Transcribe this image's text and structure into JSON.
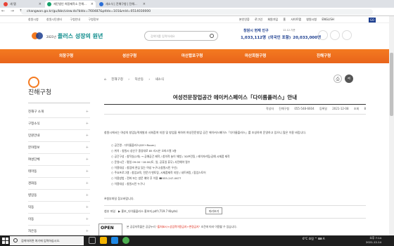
{
  "browser": {
    "tabs": [
      {
        "label": "새 탭",
        "active": false,
        "color": "#e94235"
      },
      {
        "label": "재단법인 희망제작소 진해...",
        "active": true,
        "color": "#15a06b"
      },
      {
        "label": "새소식 | 진해구청 | 진해...",
        "active": false,
        "color": "#2a6ed6"
      }
    ],
    "nav_icons": "← → ↻",
    "url": "changwon.go.kr/gu/bbs/view.do?bIdx=760487&ptIdx=101&mId=0514030000"
  },
  "util": {
    "left_links": [
      "창원시청",
      "창원시민센터",
      "구청안내",
      "구청정보"
    ],
    "right_links": [
      "본인인증",
      "로그인",
      "회원가입",
      "홈",
      "사이트맵",
      "창원시청",
      "ENGLISH"
    ],
    "go": "GO"
  },
  "logo": {
    "small": "2021년",
    "main": "플러스 성장의 원년"
  },
  "search": {
    "placeholder": "검색어를 입력하세요"
  },
  "population": {
    "title": "창원시 현재 인구",
    "date": "12.12.기준",
    "values": [
      "1,033,112명",
      "(외국인 포함)",
      "20,033,000명"
    ]
  },
  "gnb": [
    "의창구청",
    "성산구청",
    "마산합포구청",
    "마산회원구청",
    "진해구청"
  ],
  "lnb": {
    "title": "진해구청",
    "items": [
      "진해구 소개",
      "구정소식",
      "민원안내",
      "분야정보",
      "여성단체",
      "테마동",
      "경화동",
      "병암동",
      "덕동",
      "이동",
      "자은동"
    ]
  },
  "main": {
    "breadcrumb": [
      "진해구청",
      "덕산동",
      "새소식"
    ],
    "print_icon": "print-icon",
    "share_icon": "share-icon",
    "title": "여성전문창업공간 에이커스페이스「다이룸플러스」안내",
    "meta": {
      "writer_label": "작성자",
      "writer": "진해구청",
      "phone": "055-548-6604",
      "date_label": "등록일",
      "date": "2021-12-08",
      "views_label": "조회",
      "views": "8"
    },
    "intro": "창원시에서는 여성의 창업능력개발과 사회참여 지원 및 창업을 위하여 여성전문창업 공간 에이커스페이스「다이룸플러스」를 조성하여 운영하고 있으니 많은 이용 바랍니다.",
    "bullets": [
      "○ 공간명 : 다이룸플러스(DIY+Room)",
      "○ 위치 : 창원시 성산구 중앙대로 85 리시온 오피스텔 3층",
      "○ 공간구성 : 창작실(2개) → 공예공간 제작 / 창의적 놀이 체험 / 3D프린팅 / 레이저커팅/공예 시제품 제작",
      "○ 운영시간 : 평일 09:00~18:00(토, 일, 공휴일 휴무) 사전예약 필수",
      "○ 이용대상 : 창업에 관심 있는 여성 누구나(창원시민 우선)",
      "○ 주요프로그램 : 창업교육, 전문가 멘토링, 시제품제작 지원 / 네트워킹 / 팝업스토어",
      "○ 이용방법 : 전화 또는 방문 예약 후 이용 ☎055-247-0677",
      "○ 이용대상 : 창원시민 누구나"
    ],
    "ref_note": "※첨부파일 참고바랍니다.",
    "attachment": {
      "label": "첨부 파일",
      "file": "▶ 홍보_다이룸플러스 홍보지.pdf (719.7 Kbyte)",
      "preview": "미리보기"
    },
    "license": {
      "badge": "OPEN",
      "prefix": "본 공공저작물은 공공누리",
      "highlight": "\"출처표시+상업적이용금지+변경금지\"",
      "suffix": "조건에 따라 이용할 수 있습니다."
    }
  },
  "taskbar": {
    "search_placeholder": "검색하려면 여기에 입력하십시오.",
    "tray": "6°C 흐림  ^  ⌨  A",
    "time": "오후 7:14",
    "date": "2021-12-14"
  }
}
